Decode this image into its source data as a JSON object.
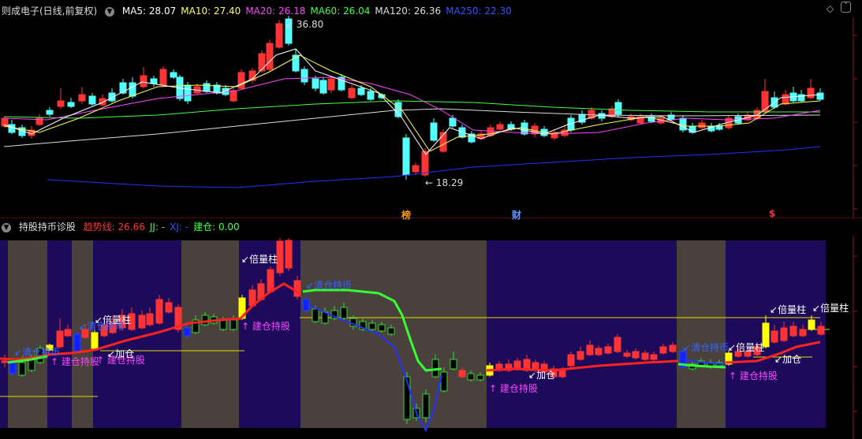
{
  "main_header": {
    "title": "则成电子(日线,前复权)",
    "ma": [
      {
        "label": "MA5: 28.07",
        "color": "#ffffff"
      },
      {
        "label": "MA10: 27.40",
        "color": "#ffff55"
      },
      {
        "label": "MA20: 26.18",
        "color": "#ff44ff"
      },
      {
        "label": "MA60: 26.04",
        "color": "#44ff44"
      },
      {
        "label": "MA120: 26.36",
        "color": "#dddddd"
      },
      {
        "label": "MA250: 22.30",
        "color": "#3355ff"
      }
    ]
  },
  "price_labels": {
    "high": "36.80",
    "low": "18.29"
  },
  "event_markers": [
    {
      "text": "榜",
      "color": "#ff9900"
    },
    {
      "text": "财",
      "color": "#6699ff"
    },
    {
      "text": "$",
      "color": "#ff3333"
    }
  ],
  "sub_header": {
    "title": "持股持币诊股",
    "items": [
      {
        "label": "趋势线: 26.66",
        "color": "#ff3333"
      },
      {
        "label": "JJ: -",
        "color": "#44ff44"
      },
      {
        "label": "XJ: -",
        "color": "#3355ff"
      },
      {
        "label": "建仓: 0.00",
        "color": "#44ff44"
      }
    ]
  },
  "annotations": {
    "beiliang": "倍量柱",
    "qingcang": "清仓持币",
    "jiancang": "建仓持股",
    "jiacang": "加仓"
  },
  "colors": {
    "up": "#ff3333",
    "down": "#54ffff",
    "trend": "#ff2222",
    "jj": "#33ff33",
    "xj": "#2233ff",
    "bg_hold": "#4a403c",
    "bg_cash": "#1e0a5a"
  }
}
